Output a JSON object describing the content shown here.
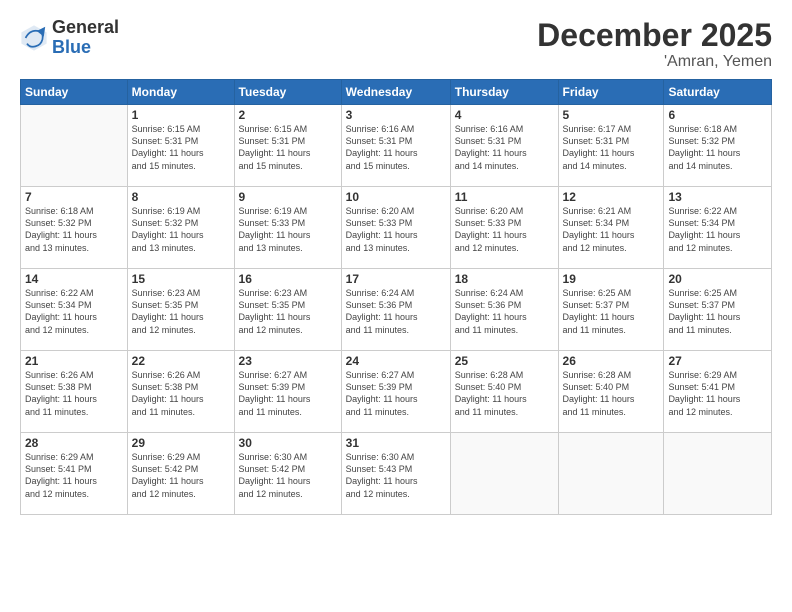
{
  "logo": {
    "general": "General",
    "blue": "Blue"
  },
  "title": "December 2025",
  "location": "'Amran, Yemen",
  "headers": [
    "Sunday",
    "Monday",
    "Tuesday",
    "Wednesday",
    "Thursday",
    "Friday",
    "Saturday"
  ],
  "weeks": [
    [
      {
        "day": "",
        "sunrise": "",
        "sunset": "",
        "daylight": ""
      },
      {
        "day": "1",
        "sunrise": "Sunrise: 6:15 AM",
        "sunset": "Sunset: 5:31 PM",
        "daylight": "Daylight: 11 hours and 15 minutes."
      },
      {
        "day": "2",
        "sunrise": "Sunrise: 6:15 AM",
        "sunset": "Sunset: 5:31 PM",
        "daylight": "Daylight: 11 hours and 15 minutes."
      },
      {
        "day": "3",
        "sunrise": "Sunrise: 6:16 AM",
        "sunset": "Sunset: 5:31 PM",
        "daylight": "Daylight: 11 hours and 15 minutes."
      },
      {
        "day": "4",
        "sunrise": "Sunrise: 6:16 AM",
        "sunset": "Sunset: 5:31 PM",
        "daylight": "Daylight: 11 hours and 14 minutes."
      },
      {
        "day": "5",
        "sunrise": "Sunrise: 6:17 AM",
        "sunset": "Sunset: 5:31 PM",
        "daylight": "Daylight: 11 hours and 14 minutes."
      },
      {
        "day": "6",
        "sunrise": "Sunrise: 6:18 AM",
        "sunset": "Sunset: 5:32 PM",
        "daylight": "Daylight: 11 hours and 14 minutes."
      }
    ],
    [
      {
        "day": "7",
        "sunrise": "Sunrise: 6:18 AM",
        "sunset": "Sunset: 5:32 PM",
        "daylight": "Daylight: 11 hours and 13 minutes."
      },
      {
        "day": "8",
        "sunrise": "Sunrise: 6:19 AM",
        "sunset": "Sunset: 5:32 PM",
        "daylight": "Daylight: 11 hours and 13 minutes."
      },
      {
        "day": "9",
        "sunrise": "Sunrise: 6:19 AM",
        "sunset": "Sunset: 5:33 PM",
        "daylight": "Daylight: 11 hours and 13 minutes."
      },
      {
        "day": "10",
        "sunrise": "Sunrise: 6:20 AM",
        "sunset": "Sunset: 5:33 PM",
        "daylight": "Daylight: 11 hours and 13 minutes."
      },
      {
        "day": "11",
        "sunrise": "Sunrise: 6:20 AM",
        "sunset": "Sunset: 5:33 PM",
        "daylight": "Daylight: 11 hours and 12 minutes."
      },
      {
        "day": "12",
        "sunrise": "Sunrise: 6:21 AM",
        "sunset": "Sunset: 5:34 PM",
        "daylight": "Daylight: 11 hours and 12 minutes."
      },
      {
        "day": "13",
        "sunrise": "Sunrise: 6:22 AM",
        "sunset": "Sunset: 5:34 PM",
        "daylight": "Daylight: 11 hours and 12 minutes."
      }
    ],
    [
      {
        "day": "14",
        "sunrise": "Sunrise: 6:22 AM",
        "sunset": "Sunset: 5:34 PM",
        "daylight": "Daylight: 11 hours and 12 minutes."
      },
      {
        "day": "15",
        "sunrise": "Sunrise: 6:23 AM",
        "sunset": "Sunset: 5:35 PM",
        "daylight": "Daylight: 11 hours and 12 minutes."
      },
      {
        "day": "16",
        "sunrise": "Sunrise: 6:23 AM",
        "sunset": "Sunset: 5:35 PM",
        "daylight": "Daylight: 11 hours and 12 minutes."
      },
      {
        "day": "17",
        "sunrise": "Sunrise: 6:24 AM",
        "sunset": "Sunset: 5:36 PM",
        "daylight": "Daylight: 11 hours and 11 minutes."
      },
      {
        "day": "18",
        "sunrise": "Sunrise: 6:24 AM",
        "sunset": "Sunset: 5:36 PM",
        "daylight": "Daylight: 11 hours and 11 minutes."
      },
      {
        "day": "19",
        "sunrise": "Sunrise: 6:25 AM",
        "sunset": "Sunset: 5:37 PM",
        "daylight": "Daylight: 11 hours and 11 minutes."
      },
      {
        "day": "20",
        "sunrise": "Sunrise: 6:25 AM",
        "sunset": "Sunset: 5:37 PM",
        "daylight": "Daylight: 11 hours and 11 minutes."
      }
    ],
    [
      {
        "day": "21",
        "sunrise": "Sunrise: 6:26 AM",
        "sunset": "Sunset: 5:38 PM",
        "daylight": "Daylight: 11 hours and 11 minutes."
      },
      {
        "day": "22",
        "sunrise": "Sunrise: 6:26 AM",
        "sunset": "Sunset: 5:38 PM",
        "daylight": "Daylight: 11 hours and 11 minutes."
      },
      {
        "day": "23",
        "sunrise": "Sunrise: 6:27 AM",
        "sunset": "Sunset: 5:39 PM",
        "daylight": "Daylight: 11 hours and 11 minutes."
      },
      {
        "day": "24",
        "sunrise": "Sunrise: 6:27 AM",
        "sunset": "Sunset: 5:39 PM",
        "daylight": "Daylight: 11 hours and 11 minutes."
      },
      {
        "day": "25",
        "sunrise": "Sunrise: 6:28 AM",
        "sunset": "Sunset: 5:40 PM",
        "daylight": "Daylight: 11 hours and 11 minutes."
      },
      {
        "day": "26",
        "sunrise": "Sunrise: 6:28 AM",
        "sunset": "Sunset: 5:40 PM",
        "daylight": "Daylight: 11 hours and 11 minutes."
      },
      {
        "day": "27",
        "sunrise": "Sunrise: 6:29 AM",
        "sunset": "Sunset: 5:41 PM",
        "daylight": "Daylight: 11 hours and 12 minutes."
      }
    ],
    [
      {
        "day": "28",
        "sunrise": "Sunrise: 6:29 AM",
        "sunset": "Sunset: 5:41 PM",
        "daylight": "Daylight: 11 hours and 12 minutes."
      },
      {
        "day": "29",
        "sunrise": "Sunrise: 6:29 AM",
        "sunset": "Sunset: 5:42 PM",
        "daylight": "Daylight: 11 hours and 12 minutes."
      },
      {
        "day": "30",
        "sunrise": "Sunrise: 6:30 AM",
        "sunset": "Sunset: 5:42 PM",
        "daylight": "Daylight: 11 hours and 12 minutes."
      },
      {
        "day": "31",
        "sunrise": "Sunrise: 6:30 AM",
        "sunset": "Sunset: 5:43 PM",
        "daylight": "Daylight: 11 hours and 12 minutes."
      },
      {
        "day": "",
        "sunrise": "",
        "sunset": "",
        "daylight": ""
      },
      {
        "day": "",
        "sunrise": "",
        "sunset": "",
        "daylight": ""
      },
      {
        "day": "",
        "sunrise": "",
        "sunset": "",
        "daylight": ""
      }
    ]
  ]
}
